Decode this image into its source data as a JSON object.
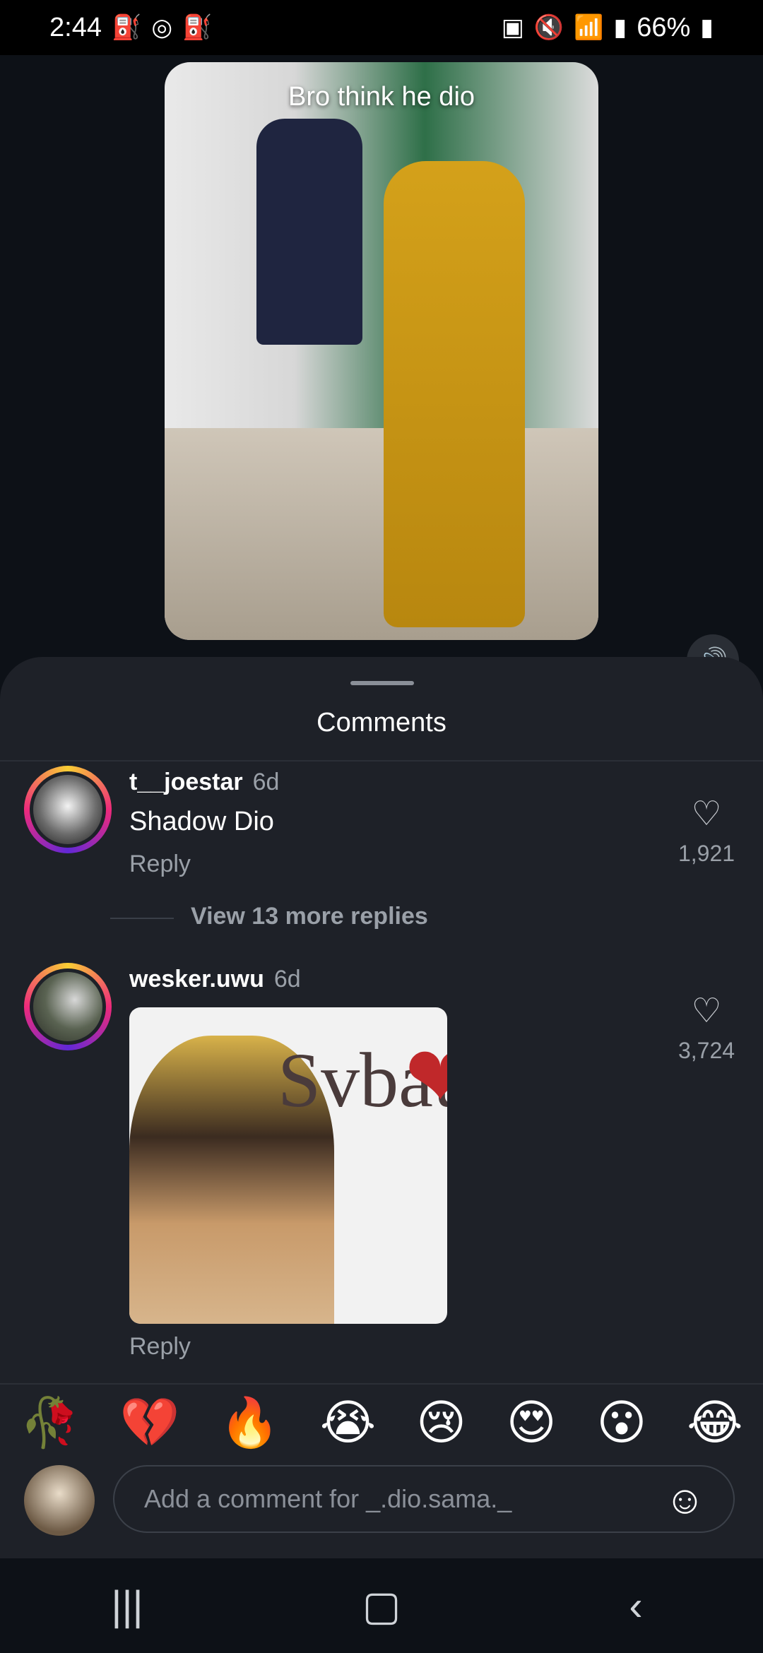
{
  "status_bar": {
    "time": "2:44",
    "battery": "66%",
    "left_icons": [
      "cake-icon",
      "record-icon",
      "cake-icon"
    ],
    "right_icons": [
      "sync-icon",
      "mute-icon",
      "wifi-icon",
      "signal-icon",
      "battery-icon"
    ]
  },
  "video": {
    "caption": "Bro think he dio"
  },
  "comments_sheet": {
    "title": "Comments",
    "comments": [
      {
        "username": "t__joestar",
        "time": "6d",
        "text": "Shadow Dio",
        "reply_label": "Reply",
        "likes": "1,921"
      },
      {
        "username": "wesker.uwu",
        "time": "6d",
        "text": "",
        "reply_label": "Reply",
        "likes": "3,724"
      }
    ],
    "view_more": "View 13 more replies",
    "meme_text": "Svbau"
  },
  "emoji_bar": [
    "🥀",
    "💔",
    "🔥",
    "😭",
    "😢",
    "😍",
    "😮",
    "😂"
  ],
  "input": {
    "placeholder": "Add a comment for _.dio.sama._"
  },
  "colors": {
    "background": "#0d1117",
    "sheet": "#1e2128",
    "story_ring_start": "#f9ce34",
    "story_ring_mid": "#ee2a7b"
  }
}
